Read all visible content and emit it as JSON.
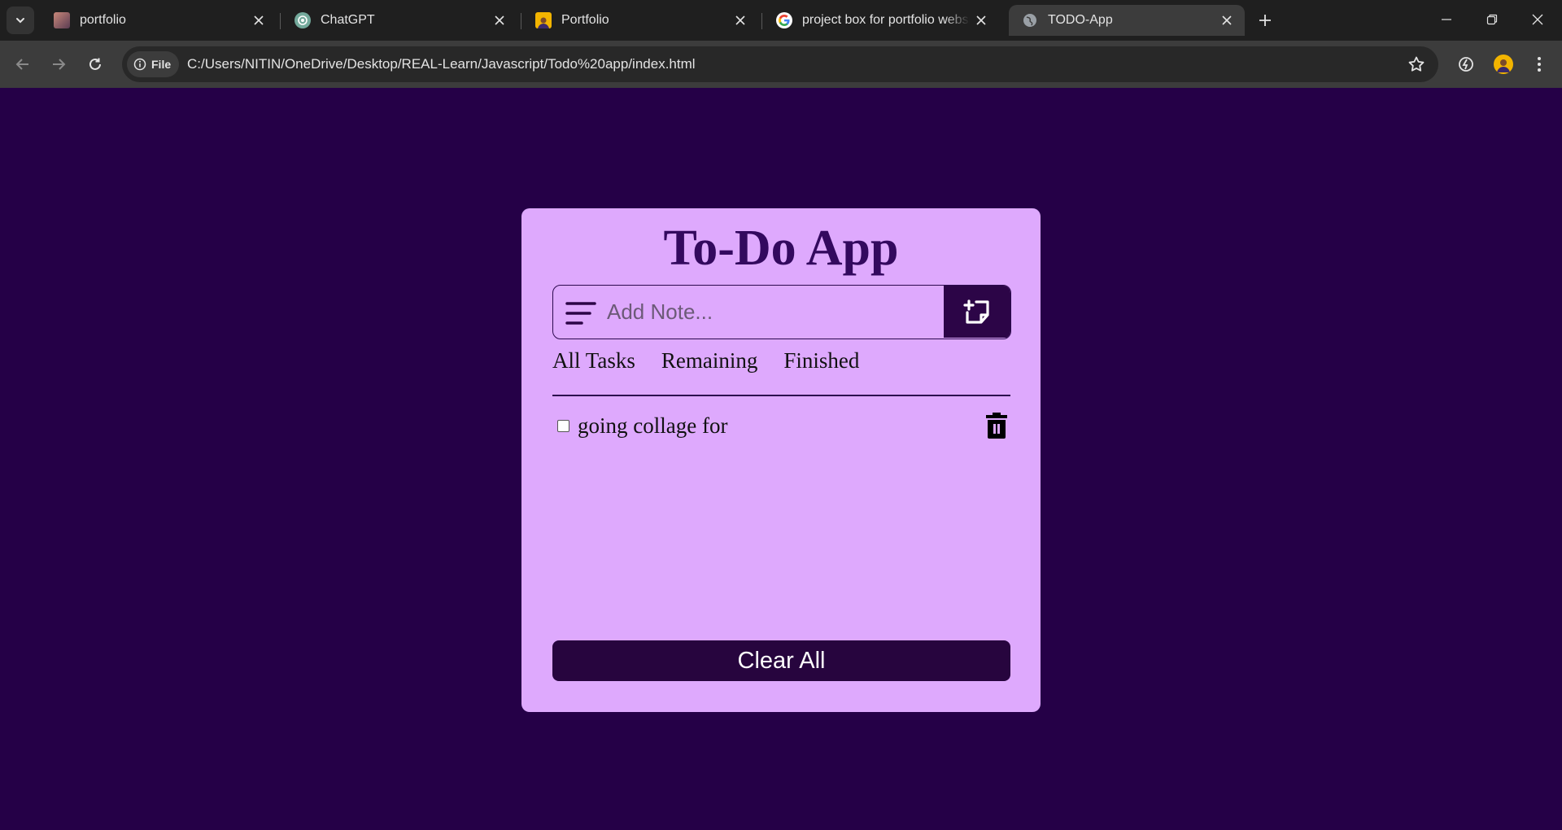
{
  "browser": {
    "tabs": [
      {
        "title": "portfolio",
        "icon": "profile-photo-icon",
        "active": false
      },
      {
        "title": "ChatGPT",
        "icon": "chatgpt-icon",
        "active": false
      },
      {
        "title": "Portfolio",
        "icon": "avatar-icon",
        "active": false
      },
      {
        "title": "project box for portfolio website",
        "icon": "google-icon",
        "active": false
      },
      {
        "title": "TODO-App",
        "icon": "globe-icon",
        "active": true
      }
    ],
    "site_chip": "File",
    "url": "C:/Users/NITIN/OneDrive/Desktop/REAL-Learn/Javascript/Todo%20app/index.html"
  },
  "app": {
    "title": "To-Do App",
    "input_placeholder": "Add Note...",
    "input_value": "",
    "filters": [
      "All Tasks",
      "Remaining",
      "Finished"
    ],
    "tasks": [
      {
        "text": "going collage for",
        "done": false
      }
    ],
    "clear_label": "Clear All"
  },
  "colors": {
    "page_bg": "#250047",
    "card_bg": "#dea9fd",
    "accent": "#2c0547",
    "title": "#33095e"
  }
}
